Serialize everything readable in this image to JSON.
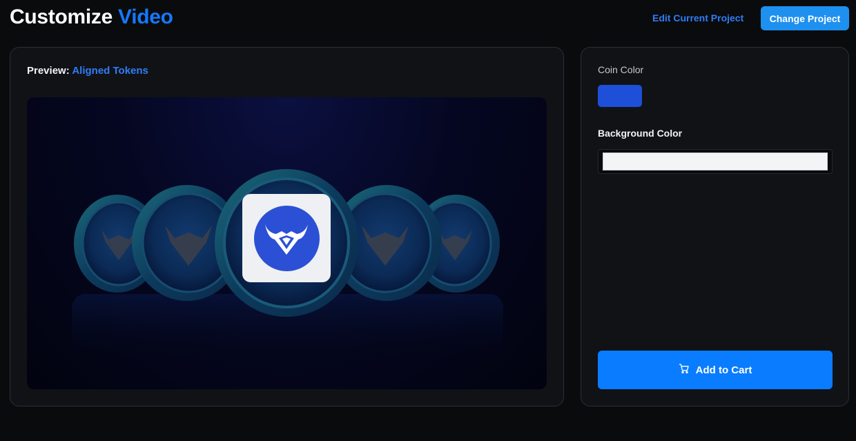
{
  "header": {
    "title_main": "Customize",
    "title_accent": "Video",
    "edit_link": "Edit Current Project",
    "change_button": "Change Project"
  },
  "preview": {
    "label": "Preview:",
    "template_name": "Aligned Tokens"
  },
  "settings": {
    "coin_color_label": "Coin Color",
    "coin_color": "#1e4fd8",
    "background_color_label": "Background Color",
    "background_color": "#f3f4f6",
    "add_to_cart": "Add to Cart"
  },
  "icons": {
    "cart": "shopping-cart-icon",
    "logo": "bull-head-logo"
  },
  "colors": {
    "accent": "#1479ff",
    "button_blue": "#0a7cff",
    "change_button": "#1e90f0",
    "panel_bg": "#111216",
    "page_bg": "#0a0b0d"
  }
}
